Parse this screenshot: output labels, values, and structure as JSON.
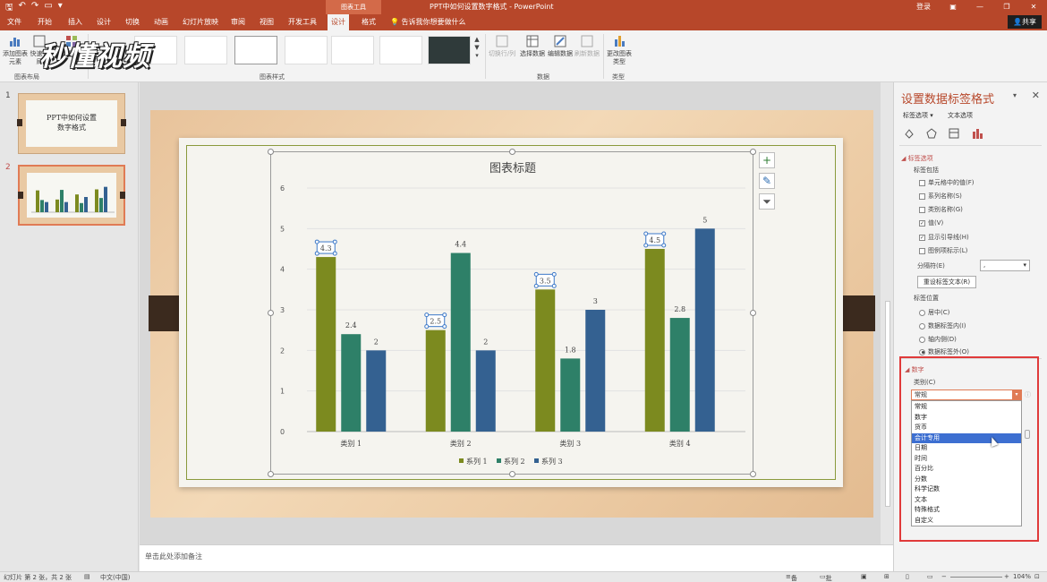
{
  "titlebar": {
    "context_label": "图表工具",
    "doc_title": "PPT中如何设置数字格式 - PowerPoint",
    "login": "登录"
  },
  "tabs": [
    "文件",
    "开始",
    "插入",
    "设计",
    "切换",
    "动画",
    "幻灯片放映",
    "审阅",
    "视图",
    "开发工具",
    "设计",
    "格式"
  ],
  "tellme": "告诉我你想要做什么",
  "share": "共享",
  "ribbon": {
    "add_element": "添加图表元素",
    "quick_layout": "快速布局",
    "colors": "颜色",
    "group_layout": "图表布局",
    "group_styles": "图表样式",
    "switch_rowcol": "切换行/列",
    "select_data": "选择数据",
    "edit_data": "编辑数据",
    "refresh_data": "刷新数据",
    "group_data": "数据",
    "change_type": "更改图表类型",
    "group_type": "类型",
    "watermark": "秒懂视频"
  },
  "thumbnails": [
    {
      "num": "1",
      "title_line1": "PPT中如何设置",
      "title_line2": "数字格式"
    },
    {
      "num": "2"
    }
  ],
  "notes_placeholder": "单击此处添加备注",
  "chart_data": {
    "type": "bar",
    "title": "图表标题",
    "categories": [
      "类别 1",
      "类别 2",
      "类别 3",
      "类别 4"
    ],
    "series": [
      {
        "name": "系列 1",
        "values": [
          4.3,
          2.5,
          3.5,
          4.5
        ],
        "color": "#7c8a1f"
      },
      {
        "name": "系列 2",
        "values": [
          2.4,
          4.4,
          1.8,
          2.8
        ],
        "color": "#2e8068"
      },
      {
        "name": "系列 3",
        "values": [
          2,
          2,
          3,
          5
        ],
        "color": "#346191"
      }
    ],
    "ylim": [
      0,
      6
    ],
    "yticks": [
      "0",
      "1",
      "2",
      "3",
      "4",
      "5",
      "6"
    ],
    "grid": true,
    "legend": "bottom",
    "selected_series": "系列 1"
  },
  "pane": {
    "title": "设置数据标签格式",
    "subtab_label_options": "标签选项",
    "subtab_text_options": "文本选项",
    "section_label_options": "标签选项",
    "label_contains": "标签包括",
    "checkboxes": [
      {
        "label": "单元格中的值(F)",
        "checked": false
      },
      {
        "label": "系列名称(S)",
        "checked": false
      },
      {
        "label": "类别名称(G)",
        "checked": false
      },
      {
        "label": "值(V)",
        "checked": true
      },
      {
        "label": "显示引导线(H)",
        "checked": true
      },
      {
        "label": "图例项标示(L)",
        "checked": false
      }
    ],
    "separator_label": "分隔符(E)",
    "separator_value": ",",
    "reset_button": "重设标签文本(R)",
    "label_position": "标签位置",
    "radios": [
      {
        "label": "居中(C)",
        "checked": false
      },
      {
        "label": "数据标签内(I)",
        "checked": false
      },
      {
        "label": "轴内侧(D)",
        "checked": false
      },
      {
        "label": "数据标签外(O)",
        "checked": true
      }
    ],
    "section_number": "数字",
    "category_label": "类别(C)",
    "category_value": "常规",
    "category_options": [
      "常规",
      "数字",
      "货币",
      "会计专用",
      "日期",
      "时间",
      "百分比",
      "分数",
      "科学记数",
      "文本",
      "特殊格式",
      "自定义"
    ],
    "hovered_option": "会计专用"
  },
  "status": {
    "slide_info": "幻灯片 第 2 张，共 2 张",
    "language": "中文(中国)",
    "notes": "备注",
    "comments": "批注",
    "zoom": "104%"
  },
  "colors": {
    "accent": "#b7472a",
    "highlight_box": "#e03a3a"
  }
}
